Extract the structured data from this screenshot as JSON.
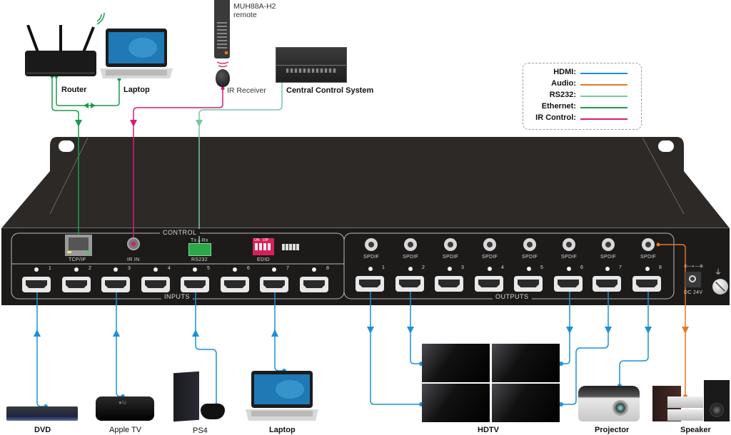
{
  "legend": {
    "items": [
      {
        "name": "HDMI:",
        "color": "#1a90d8"
      },
      {
        "name": "Audio:",
        "color": "#e87722"
      },
      {
        "name": "RS232:",
        "color": "#74c9a0"
      },
      {
        "name": "Ethernet:",
        "color": "#1a9a4e"
      },
      {
        "name": "IR Control:",
        "color": "#d81b7a"
      }
    ]
  },
  "top_devices": {
    "router": "Router",
    "laptop": "Laptop",
    "remote": "MUH88A-H2",
    "remote_sub": "remote",
    "ir_receiver": "IR Receiver",
    "central_control": "Central Control System"
  },
  "panel": {
    "control_label": "CONTROL",
    "inputs_label": "INPUTS",
    "outputs_label": "OUTPUTS",
    "tcpip": "TCP/IP",
    "ir_in": "IR IN",
    "rs232": "RS232",
    "txrx": "Tx⏚Rx",
    "edid": "EDID",
    "dip_on": "ON",
    "dip_label": "DIP",
    "spdif": "SPDIF",
    "dc": "DC 24V",
    "dc_polarity": "⊖—◐—⊕",
    "ground_symbol": "⏚",
    "input_ports": [
      "1",
      "2",
      "3",
      "4",
      "5",
      "6",
      "7",
      "8"
    ],
    "output_ports": [
      "1",
      "2",
      "3",
      "4",
      "5",
      "6",
      "7",
      "8"
    ]
  },
  "bottom_devices": {
    "dvd": "DVD",
    "apple_tv": "Apple TV",
    "ps4": "PS4",
    "laptop": "Laptop",
    "hdtv": "HDTV",
    "projector": "Projector",
    "speaker": "Speaker"
  },
  "colors": {
    "hdmi": "#1a90d8",
    "audio": "#e87722",
    "rs232": "#74c9a0",
    "ethernet": "#1a9a4e",
    "ir": "#d81b7a",
    "chassis": "#2d2926"
  }
}
